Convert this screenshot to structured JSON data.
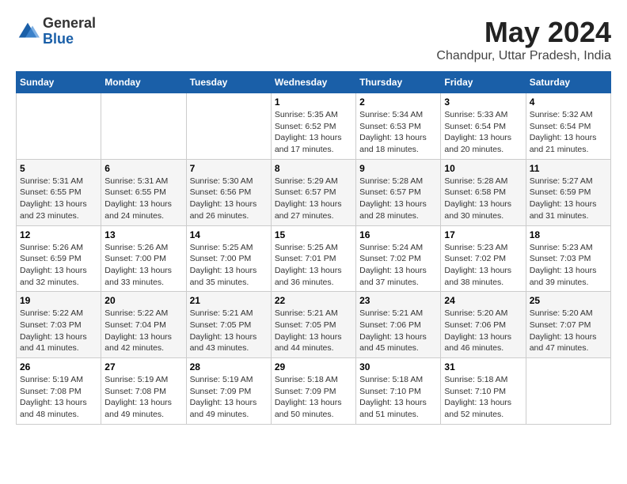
{
  "logo": {
    "general": "General",
    "blue": "Blue"
  },
  "title": "May 2024",
  "subtitle": "Chandpur, Uttar Pradesh, India",
  "days_header": [
    "Sunday",
    "Monday",
    "Tuesday",
    "Wednesday",
    "Thursday",
    "Friday",
    "Saturday"
  ],
  "weeks": [
    [
      {
        "day": "",
        "info": ""
      },
      {
        "day": "",
        "info": ""
      },
      {
        "day": "",
        "info": ""
      },
      {
        "day": "1",
        "info": "Sunrise: 5:35 AM\nSunset: 6:52 PM\nDaylight: 13 hours\nand 17 minutes."
      },
      {
        "day": "2",
        "info": "Sunrise: 5:34 AM\nSunset: 6:53 PM\nDaylight: 13 hours\nand 18 minutes."
      },
      {
        "day": "3",
        "info": "Sunrise: 5:33 AM\nSunset: 6:54 PM\nDaylight: 13 hours\nand 20 minutes."
      },
      {
        "day": "4",
        "info": "Sunrise: 5:32 AM\nSunset: 6:54 PM\nDaylight: 13 hours\nand 21 minutes."
      }
    ],
    [
      {
        "day": "5",
        "info": "Sunrise: 5:31 AM\nSunset: 6:55 PM\nDaylight: 13 hours\nand 23 minutes."
      },
      {
        "day": "6",
        "info": "Sunrise: 5:31 AM\nSunset: 6:55 PM\nDaylight: 13 hours\nand 24 minutes."
      },
      {
        "day": "7",
        "info": "Sunrise: 5:30 AM\nSunset: 6:56 PM\nDaylight: 13 hours\nand 26 minutes."
      },
      {
        "day": "8",
        "info": "Sunrise: 5:29 AM\nSunset: 6:57 PM\nDaylight: 13 hours\nand 27 minutes."
      },
      {
        "day": "9",
        "info": "Sunrise: 5:28 AM\nSunset: 6:57 PM\nDaylight: 13 hours\nand 28 minutes."
      },
      {
        "day": "10",
        "info": "Sunrise: 5:28 AM\nSunset: 6:58 PM\nDaylight: 13 hours\nand 30 minutes."
      },
      {
        "day": "11",
        "info": "Sunrise: 5:27 AM\nSunset: 6:59 PM\nDaylight: 13 hours\nand 31 minutes."
      }
    ],
    [
      {
        "day": "12",
        "info": "Sunrise: 5:26 AM\nSunset: 6:59 PM\nDaylight: 13 hours\nand 32 minutes."
      },
      {
        "day": "13",
        "info": "Sunrise: 5:26 AM\nSunset: 7:00 PM\nDaylight: 13 hours\nand 33 minutes."
      },
      {
        "day": "14",
        "info": "Sunrise: 5:25 AM\nSunset: 7:00 PM\nDaylight: 13 hours\nand 35 minutes."
      },
      {
        "day": "15",
        "info": "Sunrise: 5:25 AM\nSunset: 7:01 PM\nDaylight: 13 hours\nand 36 minutes."
      },
      {
        "day": "16",
        "info": "Sunrise: 5:24 AM\nSunset: 7:02 PM\nDaylight: 13 hours\nand 37 minutes."
      },
      {
        "day": "17",
        "info": "Sunrise: 5:23 AM\nSunset: 7:02 PM\nDaylight: 13 hours\nand 38 minutes."
      },
      {
        "day": "18",
        "info": "Sunrise: 5:23 AM\nSunset: 7:03 PM\nDaylight: 13 hours\nand 39 minutes."
      }
    ],
    [
      {
        "day": "19",
        "info": "Sunrise: 5:22 AM\nSunset: 7:03 PM\nDaylight: 13 hours\nand 41 minutes."
      },
      {
        "day": "20",
        "info": "Sunrise: 5:22 AM\nSunset: 7:04 PM\nDaylight: 13 hours\nand 42 minutes."
      },
      {
        "day": "21",
        "info": "Sunrise: 5:21 AM\nSunset: 7:05 PM\nDaylight: 13 hours\nand 43 minutes."
      },
      {
        "day": "22",
        "info": "Sunrise: 5:21 AM\nSunset: 7:05 PM\nDaylight: 13 hours\nand 44 minutes."
      },
      {
        "day": "23",
        "info": "Sunrise: 5:21 AM\nSunset: 7:06 PM\nDaylight: 13 hours\nand 45 minutes."
      },
      {
        "day": "24",
        "info": "Sunrise: 5:20 AM\nSunset: 7:06 PM\nDaylight: 13 hours\nand 46 minutes."
      },
      {
        "day": "25",
        "info": "Sunrise: 5:20 AM\nSunset: 7:07 PM\nDaylight: 13 hours\nand 47 minutes."
      }
    ],
    [
      {
        "day": "26",
        "info": "Sunrise: 5:19 AM\nSunset: 7:08 PM\nDaylight: 13 hours\nand 48 minutes."
      },
      {
        "day": "27",
        "info": "Sunrise: 5:19 AM\nSunset: 7:08 PM\nDaylight: 13 hours\nand 49 minutes."
      },
      {
        "day": "28",
        "info": "Sunrise: 5:19 AM\nSunset: 7:09 PM\nDaylight: 13 hours\nand 49 minutes."
      },
      {
        "day": "29",
        "info": "Sunrise: 5:18 AM\nSunset: 7:09 PM\nDaylight: 13 hours\nand 50 minutes."
      },
      {
        "day": "30",
        "info": "Sunrise: 5:18 AM\nSunset: 7:10 PM\nDaylight: 13 hours\nand 51 minutes."
      },
      {
        "day": "31",
        "info": "Sunrise: 5:18 AM\nSunset: 7:10 PM\nDaylight: 13 hours\nand 52 minutes."
      },
      {
        "day": "",
        "info": ""
      }
    ]
  ]
}
